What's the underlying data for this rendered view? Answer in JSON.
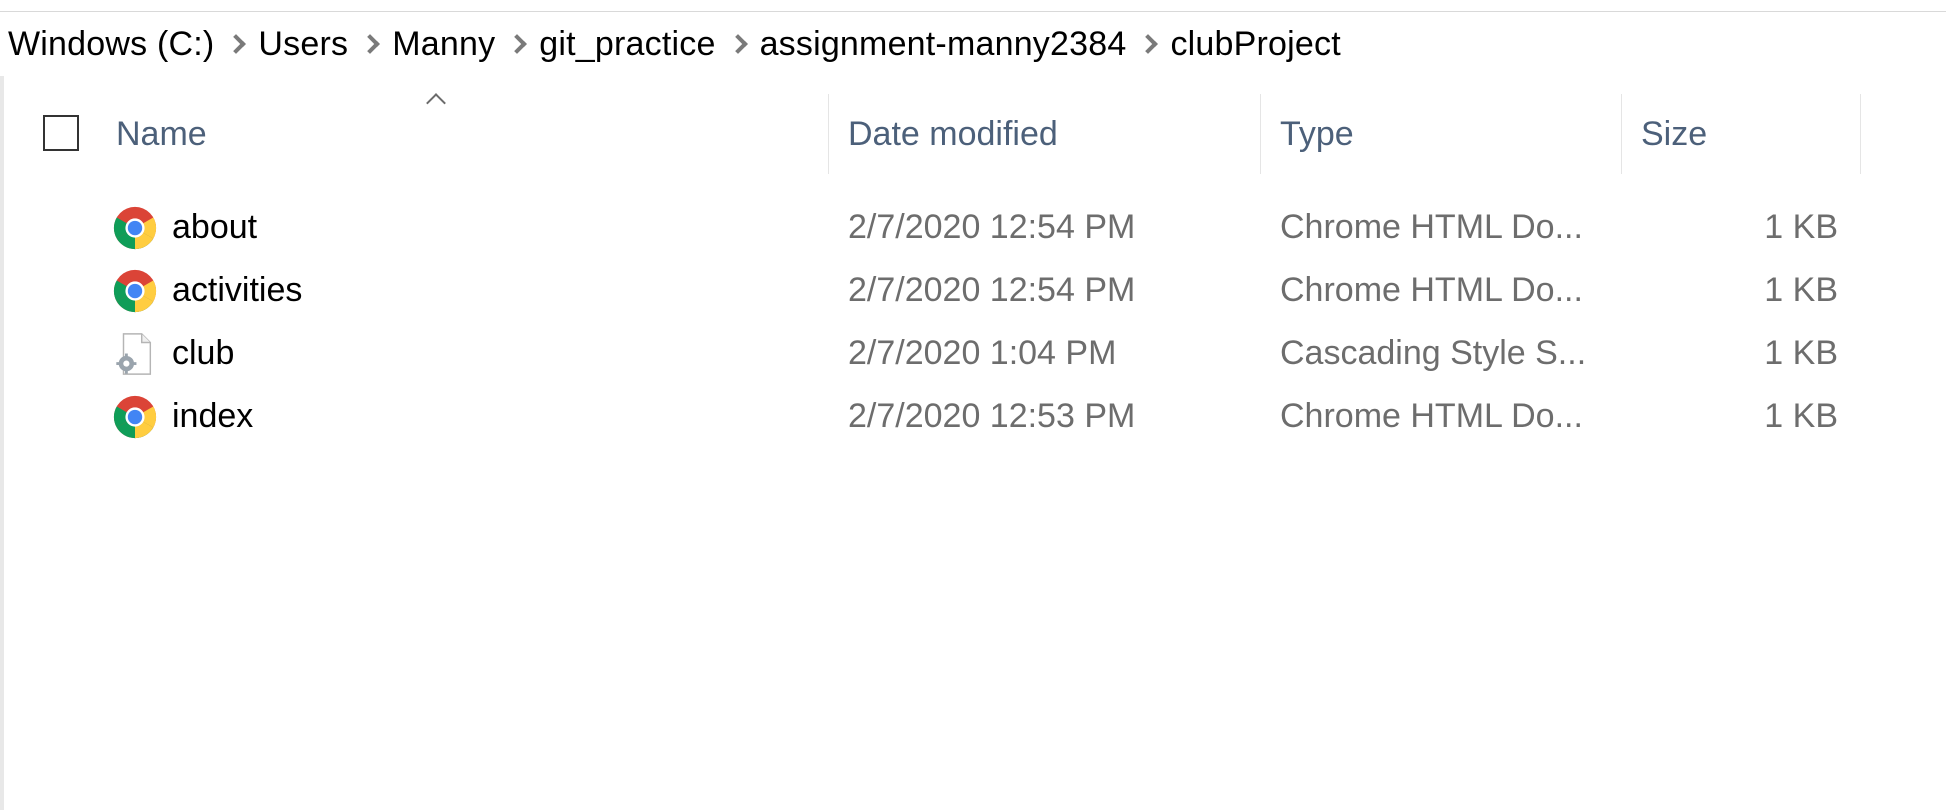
{
  "breadcrumb": [
    {
      "label": "Windows (C:)"
    },
    {
      "label": "Users"
    },
    {
      "label": "Manny"
    },
    {
      "label": "git_practice"
    },
    {
      "label": "assignment-manny2384"
    },
    {
      "label": "clubProject"
    }
  ],
  "columns": {
    "name": "Name",
    "date_modified": "Date modified",
    "type": "Type",
    "size": "Size"
  },
  "files": [
    {
      "name": "about",
      "date": "2/7/2020 12:54 PM",
      "type": "Chrome HTML Do...",
      "size": "1 KB",
      "icon": "chrome-icon"
    },
    {
      "name": "activities",
      "date": "2/7/2020 12:54 PM",
      "type": "Chrome HTML Do...",
      "size": "1 KB",
      "icon": "chrome-icon"
    },
    {
      "name": "club",
      "date": "2/7/2020 1:04 PM",
      "type": "Cascading Style S...",
      "size": "1 KB",
      "icon": "css-file-icon"
    },
    {
      "name": "index",
      "date": "2/7/2020 12:53 PM",
      "type": "Chrome HTML Do...",
      "size": "1 KB",
      "icon": "chrome-icon"
    }
  ],
  "colors": {
    "header_text": "#4c607a",
    "detail_text": "#6d6d6d",
    "chevron": "#7a7a7a"
  }
}
